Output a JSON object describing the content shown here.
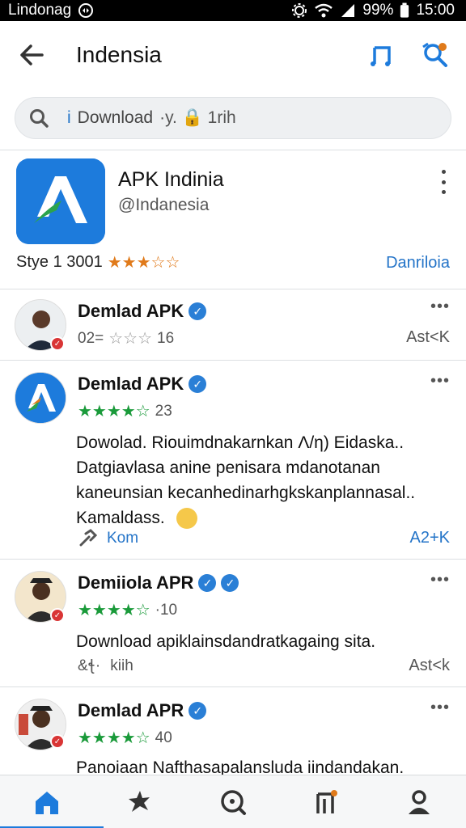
{
  "status_bar": {
    "carrier": "Lindonag",
    "battery": "99%",
    "time": "15:00"
  },
  "app_bar": {
    "title": "Indensia"
  },
  "search": {
    "text": "Download",
    "prefix": "i",
    "suffix": "·y. 🔒 1rih"
  },
  "featured_app": {
    "name": "APK Indinia",
    "handle": "@Indanesia",
    "meta": "Stye 1 3001",
    "stars": "★★★☆☆",
    "link": "Danriloia"
  },
  "reviews": [
    {
      "name": "Demlad APK",
      "rating_text": "02=",
      "stars": "☆☆☆",
      "count": "16",
      "action": "Ast<K"
    },
    {
      "name": "Demlad APK",
      "stars": "★★★★☆",
      "count": "23",
      "text": "Dowolad. Riouimdnakarnkan Λ/η) Eidaska.. Datgiavlasa anine penisara mdanotanan kaneunsian kecanhedinarhgkskanplannasal.. Kamaldass.",
      "footer_label": "Kom",
      "action": "A2+K"
    },
    {
      "name": "Demiiola APR",
      "stars": "★★★★☆",
      "count": "·10",
      "text": "Download apiklainsdandratkagaing sita.",
      "footer_label": "kiih",
      "action": "Ast<k"
    },
    {
      "name": "Demlad APR",
      "stars": "★★★★☆",
      "count": "40",
      "text": "Panoiaan Nafthasapalansluda iindandakan."
    }
  ],
  "colors": {
    "accent": "#1d7bdc",
    "star_orange": "#e07a1a",
    "star_green": "#1a9a3a",
    "verified": "#2a7fd6"
  },
  "icons": [
    "back-arrow-icon",
    "music-note-icon",
    "search-settings-icon",
    "search-icon",
    "lock-icon",
    "more-vertical-icon",
    "verified-icon",
    "more-horizontal-icon",
    "link-icon",
    "emoji-icon",
    "home-icon",
    "sparkle-icon",
    "discover-icon",
    "library-icon",
    "profile-icon"
  ]
}
